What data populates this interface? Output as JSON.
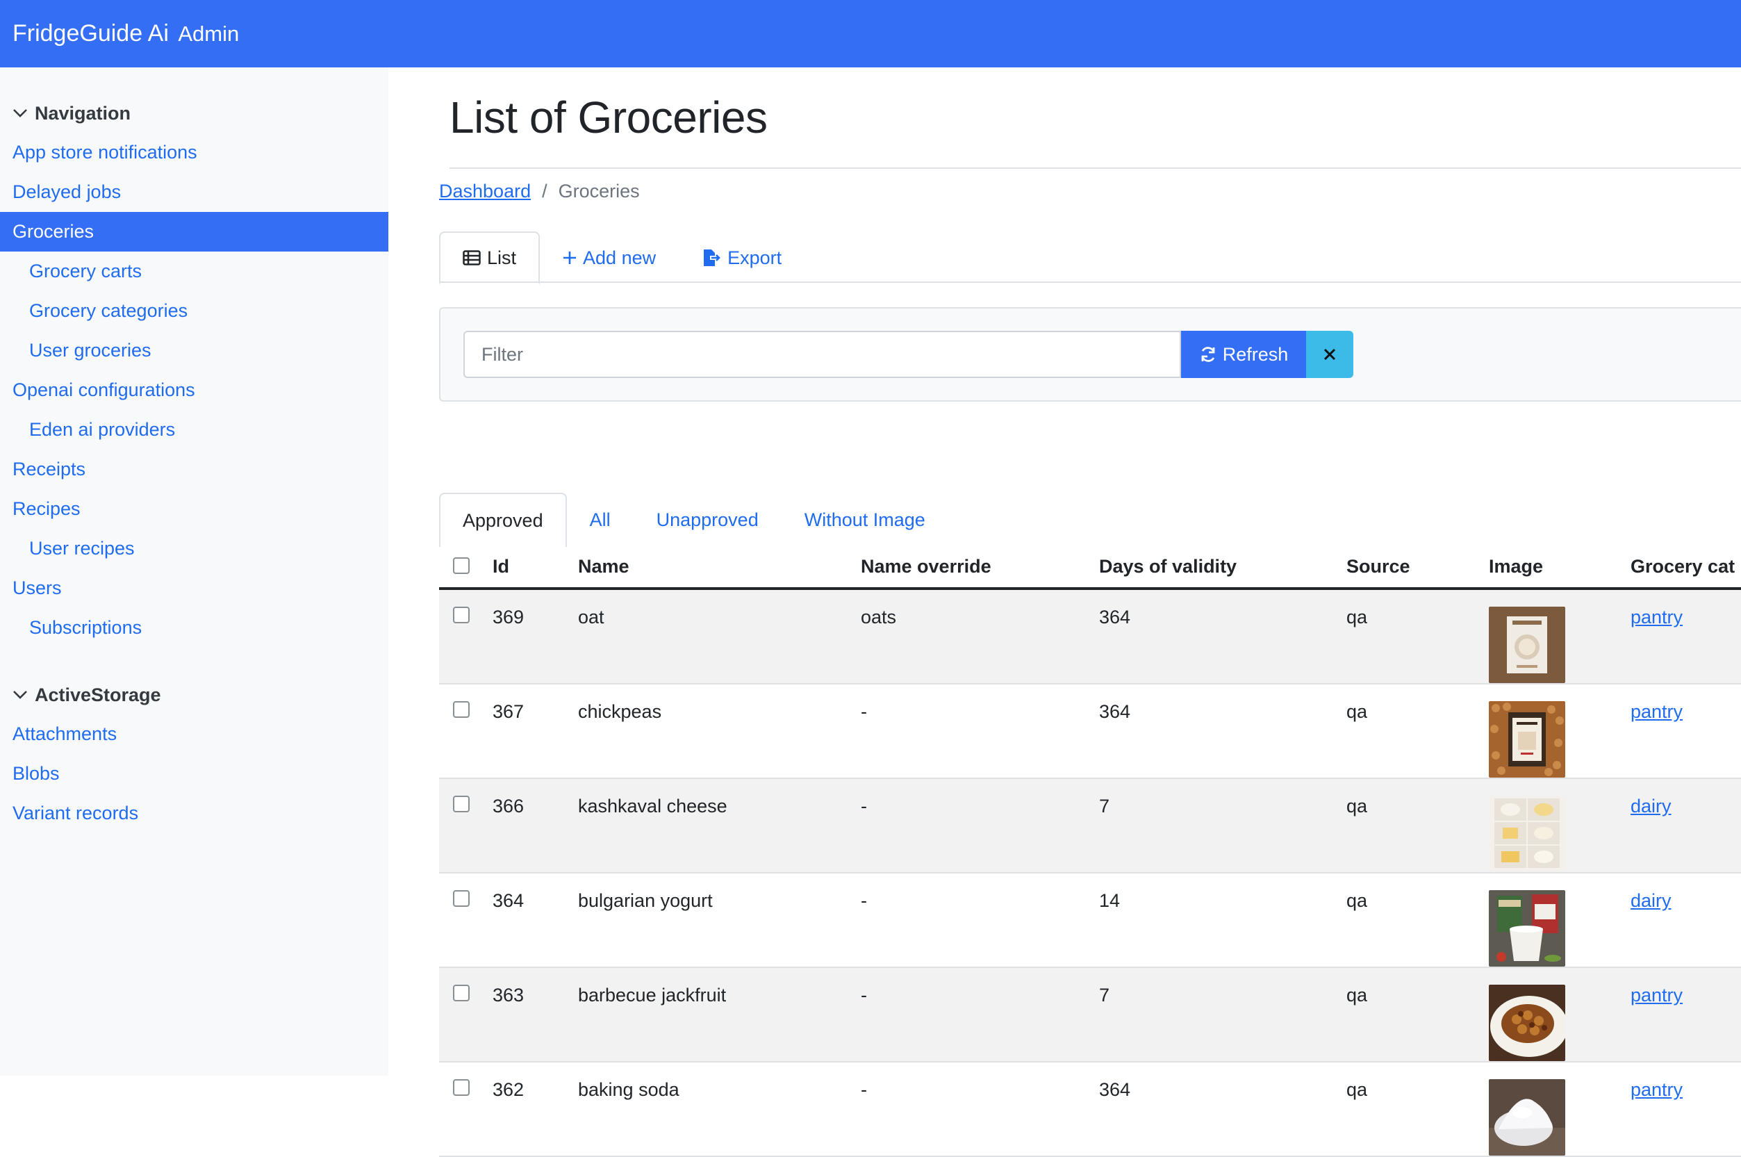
{
  "header": {
    "brand": "FridgeGuide Ai",
    "brand_suffix": "Admin"
  },
  "sidebar": {
    "sections": [
      {
        "title": "Navigation",
        "items": [
          {
            "label": "App store notifications",
            "level": 0
          },
          {
            "label": "Delayed jobs",
            "level": 0
          },
          {
            "label": "Groceries",
            "level": 0,
            "active": true
          },
          {
            "label": "Grocery carts",
            "level": 1
          },
          {
            "label": "Grocery categories",
            "level": 1
          },
          {
            "label": "User groceries",
            "level": 1
          },
          {
            "label": "Openai configurations",
            "level": 0
          },
          {
            "label": "Eden ai providers",
            "level": 1
          },
          {
            "label": "Receipts",
            "level": 0
          },
          {
            "label": "Recipes",
            "level": 0
          },
          {
            "label": "User recipes",
            "level": 1
          },
          {
            "label": "Users",
            "level": 0
          },
          {
            "label": "Subscriptions",
            "level": 1
          }
        ]
      },
      {
        "title": "ActiveStorage",
        "items": [
          {
            "label": "Attachments",
            "level": 0
          },
          {
            "label": "Blobs",
            "level": 0
          },
          {
            "label": "Variant records",
            "level": 0
          }
        ]
      }
    ]
  },
  "main": {
    "title": "List of Groceries",
    "breadcrumb": {
      "home": "Dashboard",
      "separator": "/",
      "current": "Groceries"
    },
    "action_tabs": {
      "list": "List",
      "add_new": "Add new",
      "export": "Export"
    },
    "filter": {
      "placeholder": "Filter",
      "value": "",
      "refresh_label": "Refresh"
    },
    "scope_tabs": [
      "Approved",
      "All",
      "Unapproved",
      "Without Image"
    ],
    "active_scope": "Approved",
    "table": {
      "columns": [
        "Id",
        "Name",
        "Name override",
        "Days of validity",
        "Source",
        "Image",
        "Grocery cat"
      ],
      "rows": [
        {
          "id": "369",
          "name": "oat",
          "name_override": "oats",
          "days": "364",
          "source": "qa",
          "image": "oats-package-photo",
          "category": "pantry"
        },
        {
          "id": "367",
          "name": "chickpeas",
          "name_override": "-",
          "days": "364",
          "source": "qa",
          "image": "chickpeas-package-photo",
          "category": "pantry"
        },
        {
          "id": "366",
          "name": "kashkaval cheese",
          "name_override": "-",
          "days": "7",
          "source": "qa",
          "image": "cheese-grid-photo",
          "category": "dairy"
        },
        {
          "id": "364",
          "name": "bulgarian yogurt",
          "name_override": "-",
          "days": "14",
          "source": "qa",
          "image": "yogurt-cups-photo",
          "category": "dairy"
        },
        {
          "id": "363",
          "name": "barbecue jackfruit",
          "name_override": "-",
          "days": "7",
          "source": "qa",
          "image": "jackfruit-plate-photo",
          "category": "pantry"
        },
        {
          "id": "362",
          "name": "baking soda",
          "name_override": "-",
          "days": "364",
          "source": "qa",
          "image": "baking-soda-photo",
          "category": "pantry"
        }
      ]
    }
  },
  "colors": {
    "primary": "#336ef5",
    "link": "#1f6cf0",
    "info": "#3dbbe8",
    "row_stripe": "#f2f2f2",
    "sidebar_bg": "#f8f9fb"
  }
}
